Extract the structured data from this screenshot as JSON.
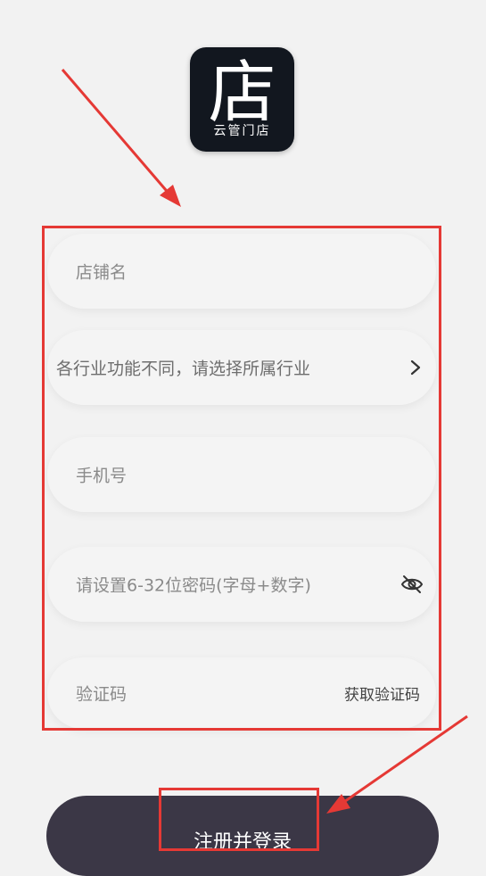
{
  "app": {
    "logo_glyph": "店",
    "logo_caption": "云管门店"
  },
  "form": {
    "store_name_placeholder": "店铺名",
    "industry_placeholder": "各行业功能不同，请选择所属行业",
    "phone_placeholder": "手机号",
    "password_placeholder": "请设置6-32位密码(字母+数字)",
    "code_placeholder": "验证码",
    "get_code_label": "获取验证码"
  },
  "submit": {
    "label": "注册并登录"
  },
  "colors": {
    "annotation": "#e53935",
    "button_bg": "#3b3746",
    "background": "#f2f2f2"
  },
  "icons": {
    "industry_chevron": "chevron-right-icon",
    "password_visibility": "eye-off-icon"
  }
}
